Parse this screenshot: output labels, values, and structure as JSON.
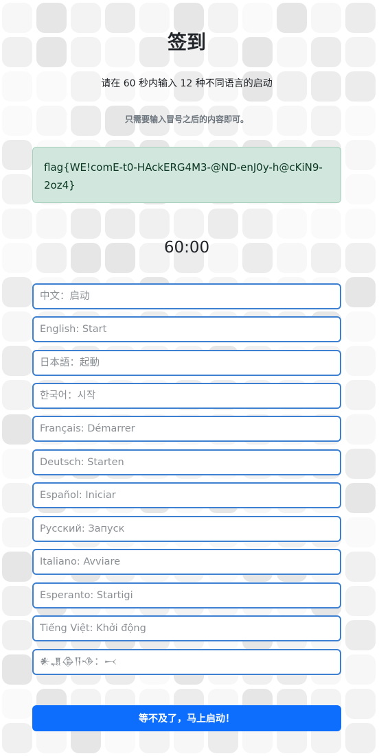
{
  "page": {
    "title": "签到",
    "subtitle": "请在 60 秒内输入 12 种不同语言的启动",
    "hint": "只需要输入冒号之后的内容即可。",
    "flag": "flag{WE!comE-t0-HAckERG4M3-@ND-enJ0y-h@cKiN9-2oz4}",
    "timer": "60:00"
  },
  "inputs": [
    {
      "placeholder": "中文：启动"
    },
    {
      "placeholder": "English: Start"
    },
    {
      "placeholder": "日本語：起動"
    },
    {
      "placeholder": "한국어：시작"
    },
    {
      "placeholder": "Français: Démarrer"
    },
    {
      "placeholder": "Deutsch: Starten"
    },
    {
      "placeholder": "Español: Iniciar"
    },
    {
      "placeholder": "Русский: Запуск"
    },
    {
      "placeholder": "Italiano: Avviare"
    },
    {
      "placeholder": "Esperanto: Startigi"
    },
    {
      "placeholder": "Tiếng Việt: Khởi động"
    },
    {
      "placeholder": "𒀭𒂗𒆠𒀀𒈾：𒁁"
    }
  ],
  "submit": {
    "label": "等不及了，马上启动！"
  },
  "colors": {
    "accent": "#0d6efd",
    "input_border": "#3d7fd1",
    "flag_bg": "#d1e7dd",
    "flag_text": "#0a3622"
  }
}
